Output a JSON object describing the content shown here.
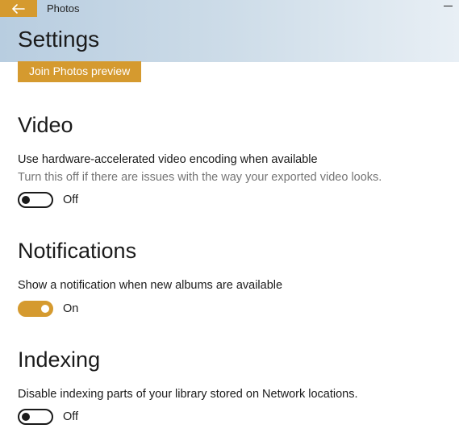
{
  "app": {
    "title": "Photos"
  },
  "page": {
    "title": "Settings"
  },
  "previewButton": {
    "label": "Join Photos preview"
  },
  "sections": {
    "video": {
      "heading": "Video",
      "settingLabel": "Use hardware-accelerated video encoding when available",
      "settingDesc": "Turn this off if there are issues with the way your exported video looks.",
      "toggleState": "Off",
      "toggleOn": false
    },
    "notifications": {
      "heading": "Notifications",
      "settingLabel": "Show a notification when new albums are available",
      "toggleState": "On",
      "toggleOn": true
    },
    "indexing": {
      "heading": "Indexing",
      "settingLabel": "Disable indexing parts of your library stored on Network locations.",
      "toggleState": "Off",
      "toggleOn": false
    }
  }
}
